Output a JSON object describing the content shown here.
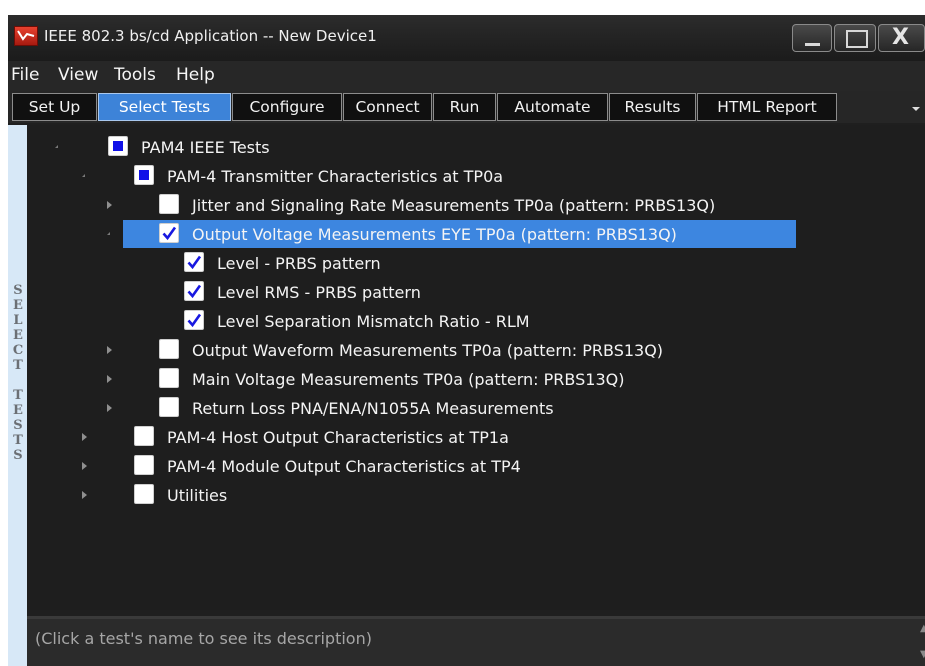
{
  "window": {
    "title": "IEEE 802.3 bs/cd Application -- New Device1",
    "close_glyph": "X"
  },
  "menu": {
    "items": [
      "File",
      "View",
      "Tools",
      "Help"
    ]
  },
  "tabs": [
    {
      "label": "Set Up",
      "active": false
    },
    {
      "label": "Select Tests",
      "active": true
    },
    {
      "label": "Configure",
      "active": false
    },
    {
      "label": "Connect",
      "active": false
    },
    {
      "label": "Run",
      "active": false
    },
    {
      "label": "Automate",
      "active": false
    },
    {
      "label": "Results",
      "active": false
    },
    {
      "label": "HTML Report",
      "active": false
    }
  ],
  "side_label": "SELECT TESTS",
  "tree": [
    {
      "label": "PAM4 IEEE Tests",
      "level": 0,
      "state": "partial",
      "expander": "expanded",
      "selected": false
    },
    {
      "label": "PAM-4 Transmitter Characteristics at TP0a",
      "level": 1,
      "state": "partial",
      "expander": "expanded",
      "selected": false
    },
    {
      "label": "Jitter and Signaling Rate Measurements TP0a (pattern: PRBS13Q)",
      "level": 2,
      "state": "unchecked",
      "expander": "collapsed",
      "selected": false
    },
    {
      "label": "Output Voltage Measurements EYE TP0a (pattern: PRBS13Q)",
      "level": 2,
      "state": "checked",
      "expander": "expanded",
      "selected": true
    },
    {
      "label": "Level - PRBS pattern",
      "level": 3,
      "state": "checked",
      "expander": "none",
      "selected": false
    },
    {
      "label": "Level RMS - PRBS pattern",
      "level": 3,
      "state": "checked",
      "expander": "none",
      "selected": false
    },
    {
      "label": "Level Separation Mismatch Ratio - RLM",
      "level": 3,
      "state": "checked",
      "expander": "none",
      "selected": false
    },
    {
      "label": "Output Waveform Measurements TP0a (pattern: PRBS13Q)",
      "level": 2,
      "state": "unchecked",
      "expander": "collapsed",
      "selected": false
    },
    {
      "label": "Main Voltage Measurements TP0a (pattern: PRBS13Q)",
      "level": 2,
      "state": "unchecked",
      "expander": "collapsed",
      "selected": false
    },
    {
      "label": "Return Loss PNA/ENA/N1055A Measurements",
      "level": 2,
      "state": "unchecked",
      "expander": "collapsed",
      "selected": false
    },
    {
      "label": "PAM-4 Host Output Characteristics at TP1a",
      "level": 1,
      "state": "unchecked",
      "expander": "collapsed",
      "selected": false
    },
    {
      "label": "PAM-4 Module Output Characteristics at TP4",
      "level": 1,
      "state": "unchecked",
      "expander": "collapsed",
      "selected": false
    },
    {
      "label": "Utilities",
      "level": 1,
      "state": "unchecked",
      "expander": "collapsed",
      "selected": false
    }
  ],
  "description": {
    "text": "(Click a test's name to see its description)"
  },
  "colors": {
    "selection": "#3d86e0",
    "active_tab": "#3d83d8",
    "partial_fill": "#1010e8",
    "check": "#1818e0"
  }
}
